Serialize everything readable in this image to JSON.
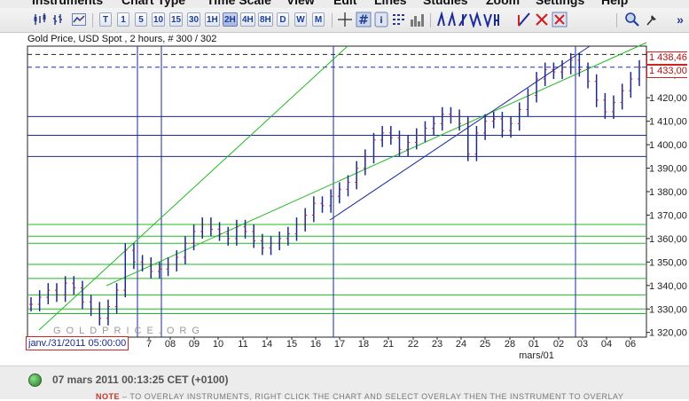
{
  "menu": [
    "Instruments",
    "Chart Type",
    "Time Scale",
    "View",
    "Edit",
    "Lines",
    "Studies",
    "Zoom",
    "Settings",
    "Help"
  ],
  "toolbar": {
    "timeframes": [
      "T",
      "1",
      "5",
      "10",
      "15",
      "30",
      "1H",
      "2H",
      "4H",
      "8H",
      "D",
      "W",
      "M"
    ],
    "active_timeframe": "2H",
    "icons": [
      "candle-chart-icon",
      "bar-chart-icon",
      "line-chart-icon",
      "crosshair-icon",
      "grid-icon",
      "info-icon",
      "data-table-icon",
      "volume-icon",
      "trendline-tools-icon",
      "delete-line-icon",
      "delete-all-icon",
      "zoom-icon",
      "pin-icon"
    ],
    "more_label": "»"
  },
  "chart": {
    "title": "Gold Price, USD Spot , 2 hours, # 300 / 302",
    "watermark": "GOLDPRICE.ORG",
    "start_label": "janv./31/2011 05:00:00",
    "current_price_label": "1 433,00",
    "high_price_label": "1 438,46",
    "month_label": "mars/01",
    "colors": {
      "candle": "#1a2a8a",
      "support_line": "#22bb22",
      "trend_line": "#1a2a9a",
      "dashed_price": "#1a2ad0",
      "price_box_border": "#cc2222"
    }
  },
  "chart_data": {
    "type": "line",
    "title": "Gold Price, USD Spot , 2 hours, # 300 / 302",
    "xlabel": "mars/01",
    "ylabel": "",
    "x_ticks": [
      "7",
      "08",
      "09",
      "10",
      "11",
      "14",
      "15",
      "16",
      "17",
      "18",
      "21",
      "22",
      "23",
      "24",
      "25",
      "28",
      "01",
      "02",
      "03",
      "04",
      "06"
    ],
    "y_ticks": [
      "1 320,00",
      "1 330,00",
      "1 340,00",
      "1 350,00",
      "1 360,00",
      "1 370,00",
      "1 380,00",
      "1 390,00",
      "1 400,00",
      "1 410,00",
      "1 420,00",
      "1 430,00"
    ],
    "ylim": [
      1318,
      1442
    ],
    "series": [
      {
        "values": [
          1332,
          1335,
          1338,
          1336,
          1341,
          1339,
          1333,
          1330,
          1326,
          1331,
          1338,
          1355,
          1350,
          1349,
          1346,
          1347,
          1349,
          1352,
          1358,
          1363,
          1366,
          1364,
          1362,
          1360,
          1365,
          1363,
          1359,
          1356,
          1358,
          1360,
          1362,
          1366,
          1370,
          1375,
          1374,
          1378,
          1381,
          1384,
          1390,
          1395,
          1402,
          1405,
          1403,
          1398,
          1401,
          1404,
          1407,
          1409,
          1413,
          1412,
          1409,
          1396,
          1405,
          1410,
          1411,
          1406,
          1409,
          1415,
          1421,
          1428,
          1432,
          1431,
          1433,
          1436,
          1432,
          1427,
          1419,
          1414,
          1418,
          1423,
          1428,
          1433
        ]
      }
    ],
    "horizontal_levels": [
      1328,
      1330,
      1336,
      1343,
      1349,
      1358,
      1361,
      1366,
      1395,
      1404,
      1412
    ],
    "dashed_levels": [
      1433.0,
      1438.46
    ],
    "grid": false
  },
  "status": {
    "timestamp": "07 mars 2011 00:13:25  CET (+0100)",
    "note_label": "NOTE",
    "note_text": "– TO OVERLAY INSTRUMENTS, RIGHT CLICK THE CHART AND SELECT OVERLAY THEN THE INSTRUMENT TO OVERLAY"
  }
}
